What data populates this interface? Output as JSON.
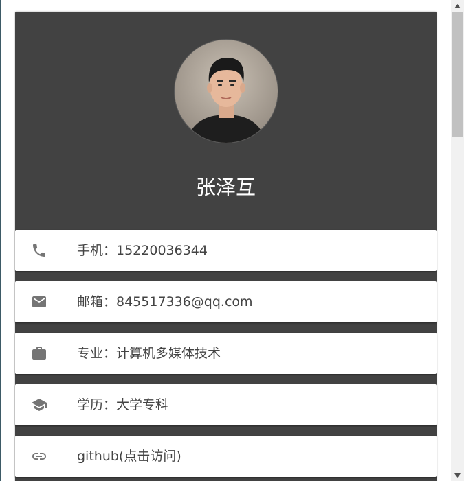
{
  "profile": {
    "name": "张泽互",
    "avatar_alt": "profile photo"
  },
  "contact_items": [
    {
      "icon": "phone-icon",
      "label": "手机：15220036344"
    },
    {
      "icon": "email-icon",
      "label": "邮箱：845517336@qq.com"
    },
    {
      "icon": "briefcase-icon",
      "label": "专业：计算机多媒体技术"
    },
    {
      "icon": "graduation-cap-icon",
      "label": "学历：大学专科"
    },
    {
      "icon": "link-icon",
      "label": "github(点击访问)"
    }
  ],
  "colors": {
    "card_background": "#424242",
    "item_background": "#ffffff",
    "icon": "#757575",
    "text": "#444444"
  }
}
